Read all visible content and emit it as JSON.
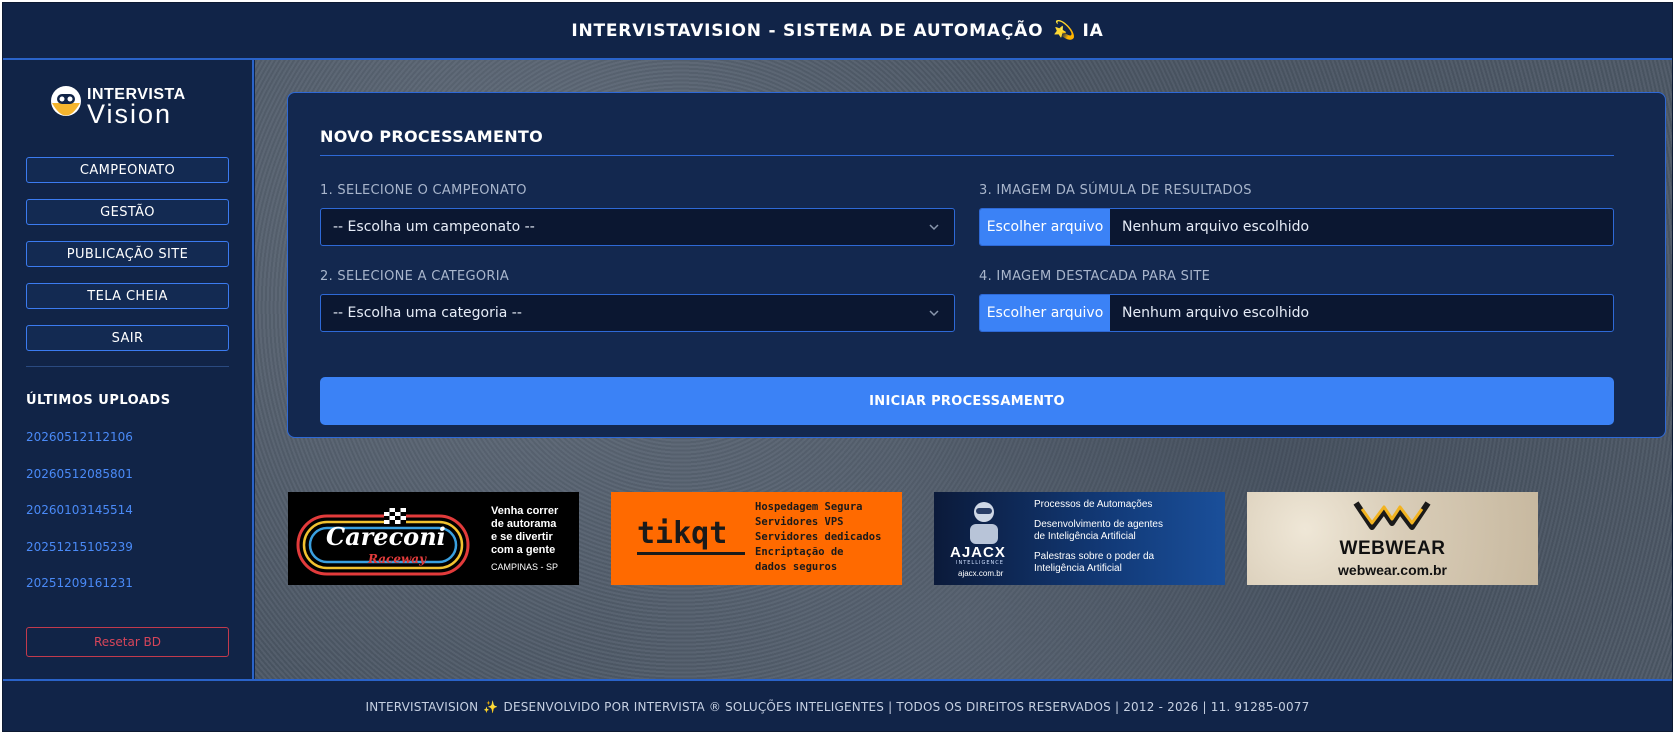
{
  "header": {
    "title_part1": "INTERVISTAVISION - SISTEMA DE AUTOMAÇÃO",
    "title_icon": "💫",
    "title_part2": "IA"
  },
  "sidebar": {
    "logo": {
      "line1": "INTERVISTA",
      "line2": "Vision"
    },
    "nav": [
      {
        "label": "CAMPEONATO"
      },
      {
        "label": "GESTÃO"
      },
      {
        "label": "PUBLICAÇÃO SITE"
      },
      {
        "label": "TELA CHEIA"
      },
      {
        "label": "SAIR"
      }
    ],
    "uploads_title": "ÚLTIMOS UPLOADS",
    "uploads": [
      "20260512112106",
      "20260512085801",
      "20260103145514",
      "20251215105239",
      "20251209161231"
    ],
    "reset_label": "Resetar BD"
  },
  "form": {
    "title": "NOVO PROCESSAMENTO",
    "championship": {
      "label": "1. SELECIONE O CAMPEONATO",
      "value": "-- Escolha um campeonato --"
    },
    "category": {
      "label": "2. SELECIONE A CATEGORIA",
      "value": "-- Escolha uma categoria --"
    },
    "results_image": {
      "label": "3. IMAGEM DA SÚMULA DE RESULTADOS",
      "button": "Escolher arquivo",
      "file": "Nenhum arquivo escolhido"
    },
    "featured_image": {
      "label": "4. IMAGEM DESTACADA PARA SITE",
      "button": "Escolher arquivo",
      "file": "Nenhum arquivo escolhido"
    },
    "submit_label": "INICIAR PROCESSAMENTO"
  },
  "banners": {
    "careconi": {
      "name": "Careconi",
      "sub": "Raceway",
      "text": [
        "Venha correr",
        "de autorama",
        "e se divertir",
        "com a gente"
      ],
      "city": "CAMPINAS - SP"
    },
    "tikqt": {
      "name": "tikqt",
      "lines": [
        "Hospedagem Segura",
        "Servidores VPS",
        "Servidores dedicados",
        "Encriptação de",
        "dados seguros"
      ]
    },
    "ajacx": {
      "name": "AJACX",
      "sub": "INTELLIGENCE",
      "site": "ajacx.com.br",
      "lines": [
        "Processos de Automações",
        "Desenvolvimento de agentes",
        "de Inteligência Artificial",
        "Palestras sobre o poder da",
        "Inteligência Artificial"
      ]
    },
    "webwear": {
      "name": "WEBWEAR",
      "site": "webwear.com.br"
    }
  },
  "footer": {
    "part1": "INTERVISTAVISION",
    "icon": "✨",
    "part2": "DESENVOLVIDO POR INTERVISTA ® SOLUÇÕES INTELIGENTES | TODOS OS DIREITOS RESERVADOS | 2012 - 2026 | 11. 91285-0077"
  },
  "colors": {
    "accent": "#3b82f6",
    "panel": "#13284f",
    "danger": "#d6455a"
  }
}
